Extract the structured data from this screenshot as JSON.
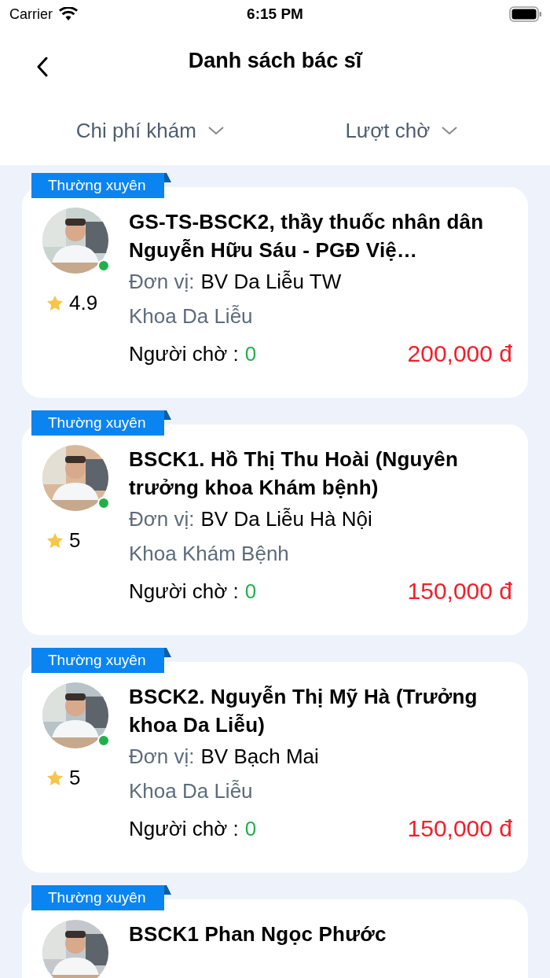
{
  "status_bar": {
    "carrier": "Carrier",
    "time": "6:15 PM"
  },
  "header": {
    "title": "Danh sách bác sĩ"
  },
  "filters": [
    {
      "label": "Chi phí khám"
    },
    {
      "label": "Lượt chờ"
    }
  ],
  "doctors": [
    {
      "badge": "Thường xuyên",
      "name": "GS-TS-BSCK2, thầy thuốc nhân dân Nguyễn Hữu Sáu - PGĐ Việ…",
      "online": true,
      "rating": "4.9",
      "unit_label": "Đơn vị:",
      "unit": "BV Da Liễu TW",
      "department": "Khoa Da Liễu",
      "waiting_label": "Người chờ :",
      "waiting": "0",
      "price": "200,000 đ"
    },
    {
      "badge": "Thường xuyên",
      "name": "BSCK1. Hồ Thị Thu Hoài (Nguyên trưởng khoa Khám bệnh)",
      "online": true,
      "rating": "5",
      "unit_label": "Đơn vị:",
      "unit": "BV Da Liễu Hà Nội",
      "department": "Khoa Khám Bệnh",
      "waiting_label": "Người chờ :",
      "waiting": "0",
      "price": "150,000 đ"
    },
    {
      "badge": "Thường xuyên",
      "name": "BSCK2. Nguyễn Thị Mỹ Hà (Trưởng khoa Da Liễu)",
      "online": true,
      "rating": "5",
      "unit_label": "Đơn vị:",
      "unit": "BV Bạch Mai",
      "department": "Khoa Da Liễu",
      "waiting_label": "Người chờ :",
      "waiting": "0",
      "price": "150,000 đ"
    },
    {
      "badge": "Thường xuyên",
      "name": "BSCK1 Phan Ngọc Phước"
    }
  ]
}
